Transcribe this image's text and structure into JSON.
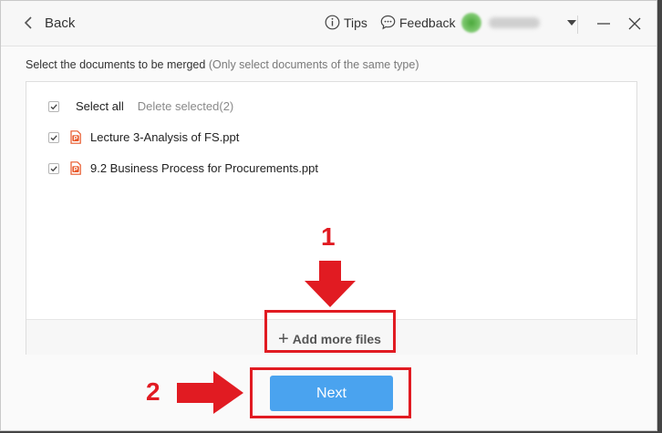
{
  "header": {
    "back_label": "Back",
    "tips_label": "Tips",
    "feedback_label": "Feedback"
  },
  "instruction": {
    "main": "Select the documents to be merged",
    "note": "(Only select documents of the same type)"
  },
  "file_list": {
    "select_all_label": "Select all",
    "select_all_checked": true,
    "delete_selected_label": "Delete selected(2)",
    "files": [
      {
        "name": "Lecture 3-Analysis of FS.ppt",
        "checked": true,
        "icon": "ppt-icon"
      },
      {
        "name": "9.2 Business Process for Procurements.ppt",
        "checked": true,
        "icon": "ppt-icon"
      }
    ]
  },
  "add_more_label": "Add more files",
  "next_label": "Next",
  "annotations": {
    "step1": "1",
    "step2": "2"
  },
  "colors": {
    "accent": "#4aa3ef",
    "annotation_red": "#e11b22",
    "ppt_orange": "#e8582a"
  }
}
